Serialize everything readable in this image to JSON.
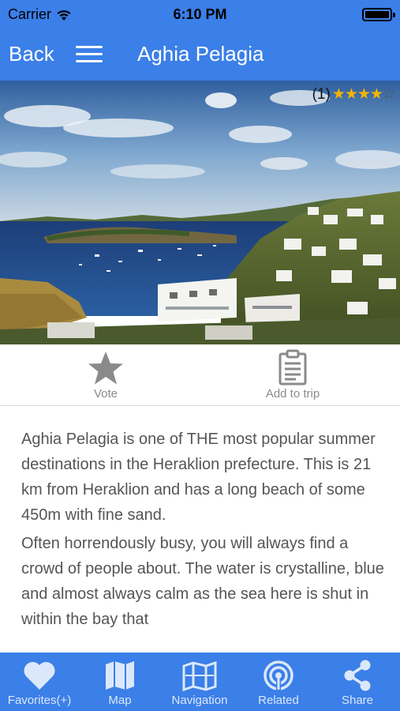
{
  "status_bar": {
    "carrier": "Carrier",
    "time": "6:10 PM"
  },
  "nav": {
    "back_label": "Back",
    "title": "Aghia Pelagia"
  },
  "hero": {
    "rating_count": "(1)",
    "rating_stars": "★★★★",
    "rating_empty": "☆",
    "rating_value": 4,
    "rating_max": 5
  },
  "actions": {
    "vote_label": "Vote",
    "add_trip_label": "Add to trip"
  },
  "description": {
    "paragraphs": [
      "Aghia Pelagia is one of THE most popular summer destinations in the Heraklion prefecture. This is 21 km from Heraklion and has a long beach of some 450m with fine sand.",
      "Often horrendously busy, you will always find a crowd of people about. The water is crystalline, blue and almost always calm as the sea here is shut in within the bay that"
    ]
  },
  "tabs": [
    {
      "label": "Favorites(+)",
      "icon": "heart-icon"
    },
    {
      "label": "Map",
      "icon": "map-icon"
    },
    {
      "label": "Navigation",
      "icon": "navigation-map-icon"
    },
    {
      "label": "Related",
      "icon": "related-signal-icon"
    },
    {
      "label": "Share",
      "icon": "share-icon"
    }
  ],
  "colors": {
    "accent": "#3b7fe8",
    "star": "#f4b400",
    "text": "#555555",
    "action_icon": "#8a8a8a"
  }
}
